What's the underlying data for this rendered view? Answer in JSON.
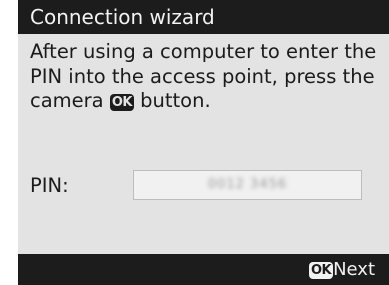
{
  "header": {
    "title": "Connection wizard"
  },
  "message": {
    "line1": "After using a computer to enter the",
    "line2": "PIN into the access point, press the",
    "line3_before": "camera ",
    "ok_badge": "OK",
    "line3_after": " button."
  },
  "pin": {
    "label": "PIN:",
    "value": "0012 3456"
  },
  "footer": {
    "ok_badge": "OK",
    "next_label": "Next"
  }
}
